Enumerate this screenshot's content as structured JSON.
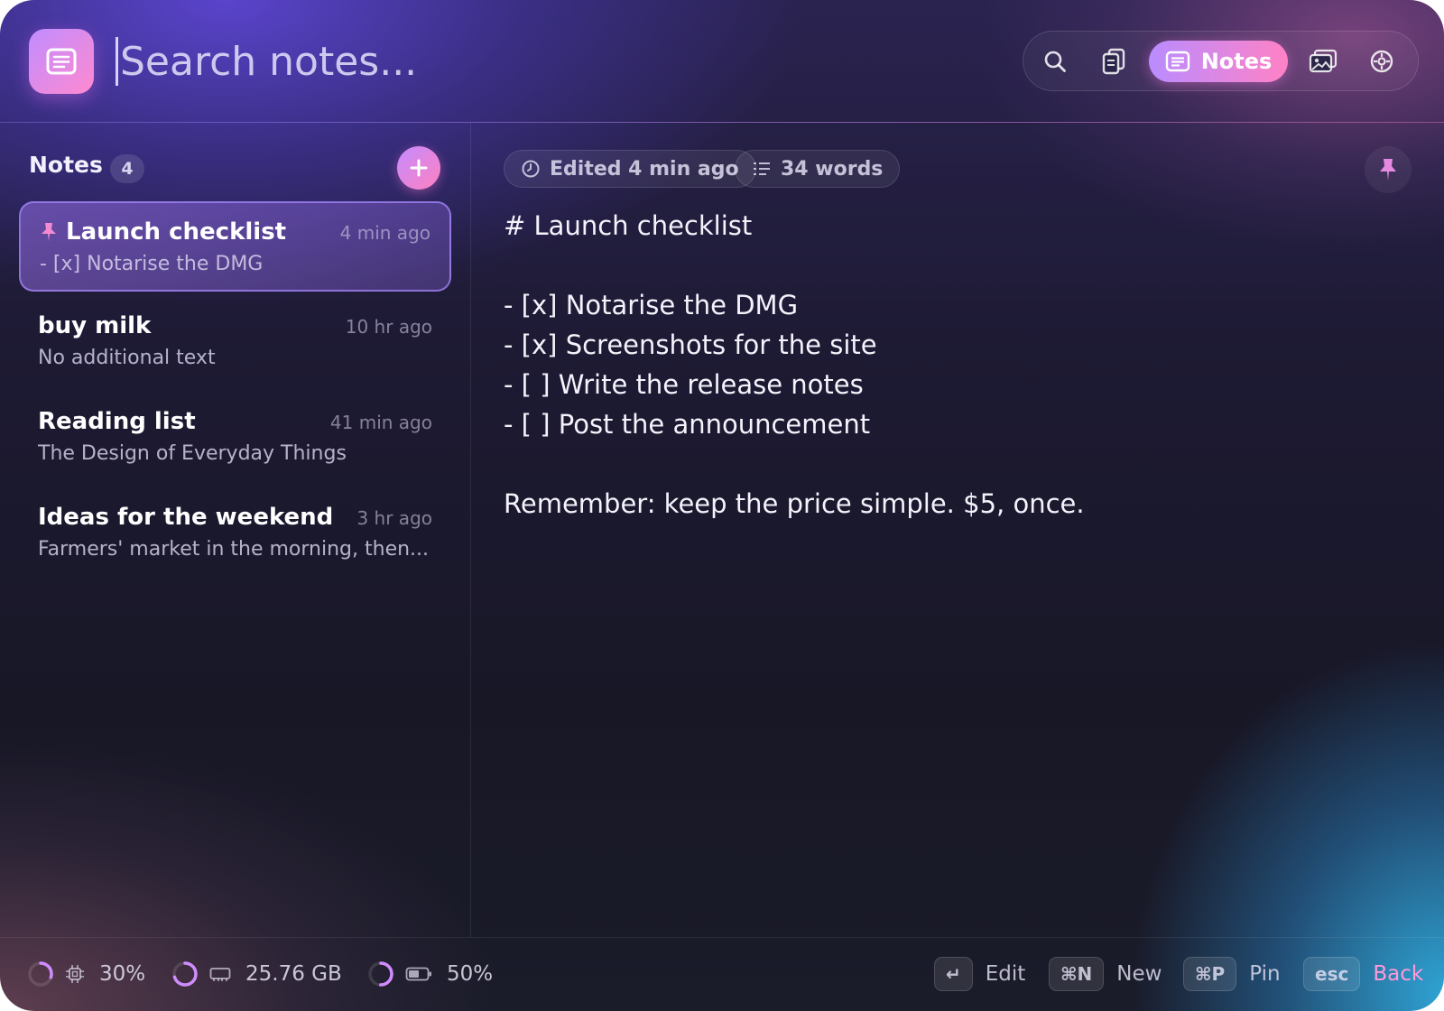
{
  "search": {
    "placeholder": "Search notes..."
  },
  "nav": {
    "items": [
      {
        "icon": "search-icon"
      },
      {
        "icon": "clipboard-icon"
      },
      {
        "icon": "notes-icon",
        "label": "Notes",
        "active": true
      },
      {
        "icon": "images-icon"
      },
      {
        "icon": "settings-icon"
      }
    ]
  },
  "sidebar": {
    "title": "Notes",
    "count": "4",
    "notes": [
      {
        "title": "Launch checklist",
        "time": "4 min ago",
        "preview": "- [x] Notarise the DMG",
        "pinned": true,
        "selected": true
      },
      {
        "title": "buy milk",
        "time": "10 hr ago",
        "preview": "No additional text"
      },
      {
        "title": "Reading list",
        "time": "41 min ago",
        "preview": "The Design of Everyday Things"
      },
      {
        "title": "Ideas for the weekend",
        "time": "3 hr ago",
        "preview": "Farmers' market in the morning, then..."
      }
    ]
  },
  "editor": {
    "edited": "Edited 4 min ago",
    "words": "34 words",
    "content": "# Launch checklist\n\n- [x] Notarise the DMG\n- [x] Screenshots for the site\n- [ ] Write the release notes\n- [ ] Post the announcement\n\nRemember: keep the price simple. $5, once."
  },
  "status": {
    "cpu": {
      "value": "30%",
      "percent": 30
    },
    "memory": {
      "value": "25.76 GB",
      "percent": 70
    },
    "battery": {
      "value": "50%",
      "percent": 50
    }
  },
  "shortcuts": [
    {
      "key": "↵",
      "action": "Edit"
    },
    {
      "key": "⌘N",
      "action": "New"
    },
    {
      "key": "⌘P",
      "action": "Pin"
    },
    {
      "key": "esc",
      "action": "Back"
    }
  ],
  "colors": {
    "accent_start": "#b98cff",
    "accent_end": "#ff82c6",
    "ring": "#d08cff"
  }
}
